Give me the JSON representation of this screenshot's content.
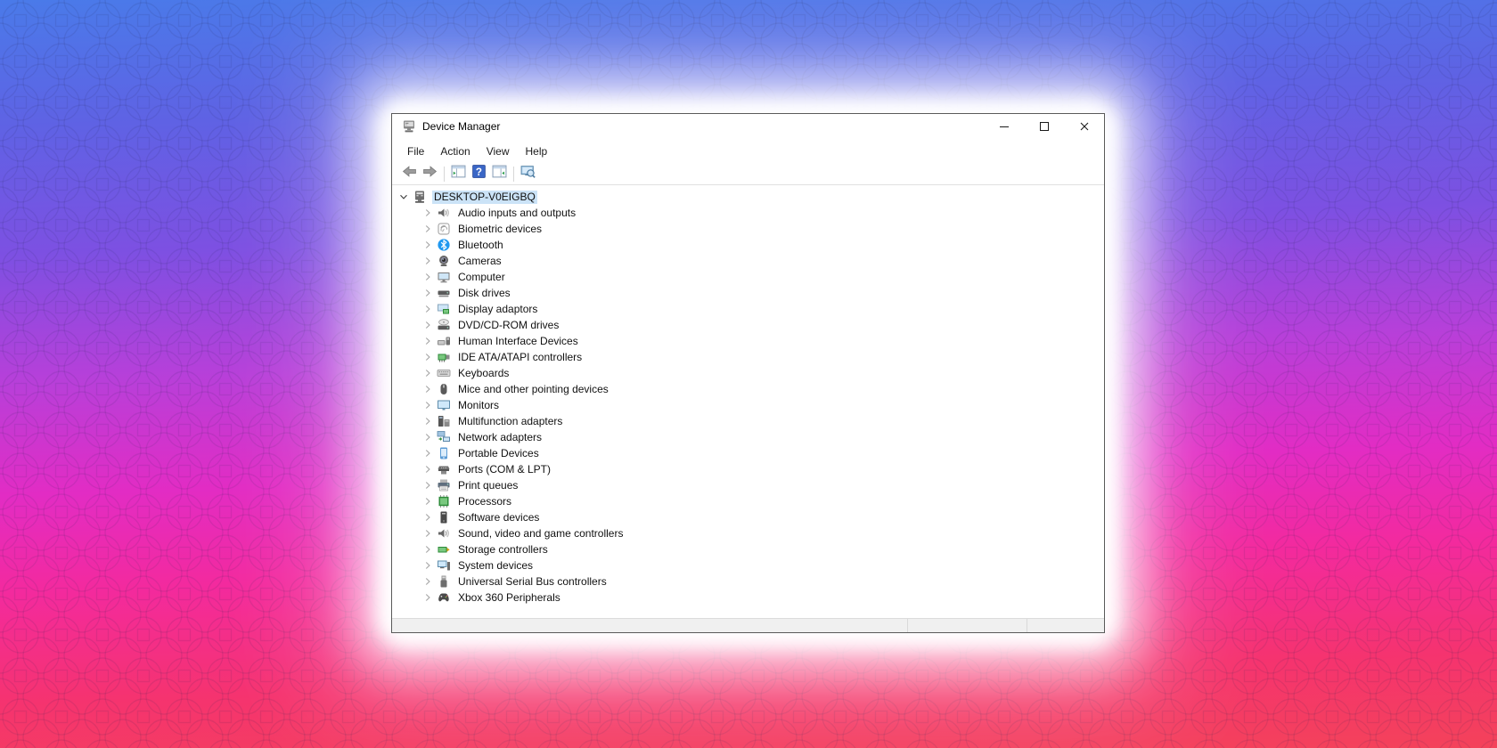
{
  "window": {
    "title": "Device Manager",
    "app_icon": "device-manager-icon",
    "controls": [
      "minimize",
      "maximize",
      "close"
    ]
  },
  "menu_bar": {
    "items": [
      "File",
      "Action",
      "View",
      "Help"
    ]
  },
  "toolbar": {
    "buttons": [
      {
        "name": "back",
        "icon": "back-arrow-icon"
      },
      {
        "name": "forward",
        "icon": "forward-arrow-icon"
      },
      {
        "name": "show-hide-console-tree",
        "icon": "console-tree-icon"
      },
      {
        "name": "help",
        "icon": "help-icon"
      },
      {
        "name": "show-hide-action-pane",
        "icon": "action-pane-icon"
      },
      {
        "name": "scan-for-hardware-changes",
        "icon": "scan-computer-icon"
      }
    ]
  },
  "tree": {
    "root": {
      "label": "DESKTOP-V0EIGBQ",
      "icon": "computer",
      "expanded": true,
      "selected": true
    },
    "items": [
      {
        "label": "Audio inputs and outputs",
        "icon": "audio"
      },
      {
        "label": "Biometric devices",
        "icon": "biometric"
      },
      {
        "label": "Bluetooth",
        "icon": "bluetooth"
      },
      {
        "label": "Cameras",
        "icon": "camera"
      },
      {
        "label": "Computer",
        "icon": "computer-monitor"
      },
      {
        "label": "Disk drives",
        "icon": "disk"
      },
      {
        "label": "Display adaptors",
        "icon": "display-adapter"
      },
      {
        "label": "DVD/CD-ROM drives",
        "icon": "dvd"
      },
      {
        "label": "Human Interface Devices",
        "icon": "hid"
      },
      {
        "label": "IDE ATA/ATAPI controllers",
        "icon": "ide"
      },
      {
        "label": "Keyboards",
        "icon": "keyboard"
      },
      {
        "label": "Mice and other pointing devices",
        "icon": "mouse"
      },
      {
        "label": "Monitors",
        "icon": "monitor"
      },
      {
        "label": "Multifunction adapters",
        "icon": "multifunction"
      },
      {
        "label": "Network adapters",
        "icon": "network"
      },
      {
        "label": "Portable Devices",
        "icon": "portable"
      },
      {
        "label": "Ports (COM & LPT)",
        "icon": "ports"
      },
      {
        "label": "Print queues",
        "icon": "printer"
      },
      {
        "label": "Processors",
        "icon": "processor"
      },
      {
        "label": "Software devices",
        "icon": "software"
      },
      {
        "label": "Sound, video and game controllers",
        "icon": "sound"
      },
      {
        "label": "Storage controllers",
        "icon": "storage"
      },
      {
        "label": "System devices",
        "icon": "system"
      },
      {
        "label": "Universal Serial Bus controllers",
        "icon": "usb"
      },
      {
        "label": "Xbox 360 Peripherals",
        "icon": "xbox"
      }
    ]
  },
  "status_bar": {
    "panes": [
      "",
      "",
      ""
    ]
  },
  "colors": {
    "bg_top": "#4a7ae9",
    "bg_mid": "#b83fd9",
    "bg_bottom": "#f4425a",
    "selection_highlight": "#cbe3f7",
    "help_button_blue": "#3a66c6",
    "glow": "#ffffff"
  }
}
